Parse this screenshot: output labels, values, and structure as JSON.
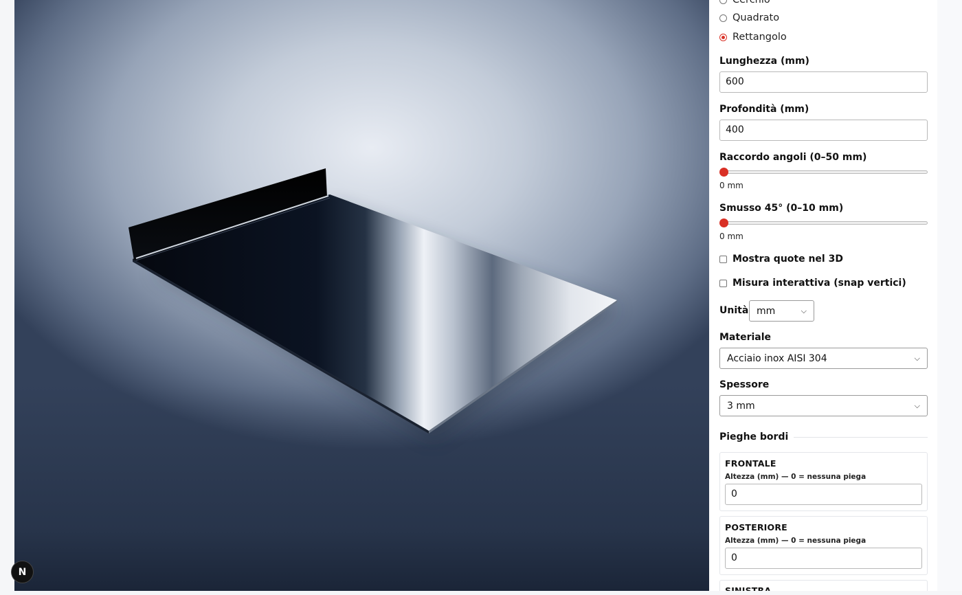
{
  "shape": {
    "options": [
      {
        "label": "Cerchio",
        "checked": false
      },
      {
        "label": "Quadrato",
        "checked": false
      },
      {
        "label": "Rettangolo",
        "checked": true
      }
    ]
  },
  "dimensions": {
    "length_label": "Lunghezza (mm)",
    "length_value": "600",
    "depth_label": "Profondità (mm)",
    "depth_value": "400"
  },
  "corner_radius": {
    "label": "Raccordo angoli (0–50 mm)",
    "value_text": "0 mm",
    "value": 0,
    "min": 0,
    "max": 50
  },
  "chamfer": {
    "label": "Smusso 45° (0–10 mm)",
    "value_text": "0 mm",
    "value": 0,
    "min": 0,
    "max": 10
  },
  "toggles": {
    "show_dimensions_label": "Mostra quote nel 3D",
    "show_dimensions_checked": false,
    "interactive_measure_label": "Misura interattiva (snap vertici)",
    "interactive_measure_checked": false
  },
  "unit": {
    "label": "Unità",
    "value": "mm"
  },
  "material": {
    "label": "Materiale",
    "value": "Acciaio inox AISI 304"
  },
  "thickness": {
    "label": "Spessore",
    "value": "3 mm"
  },
  "folds": {
    "title": "Pieghe bordi",
    "items": [
      {
        "name": "FRONTALE",
        "hint": "Altezza (mm) — 0 = nessuna piega",
        "value": "0"
      },
      {
        "name": "POSTERIORE",
        "hint": "Altezza (mm) — 0 = nessuna piega",
        "value": "0"
      },
      {
        "name": "SINISTRA"
      }
    ]
  },
  "badge": {
    "letter": "N"
  },
  "colors": {
    "accent": "#d93025",
    "panel_bg": "#ffffff"
  }
}
